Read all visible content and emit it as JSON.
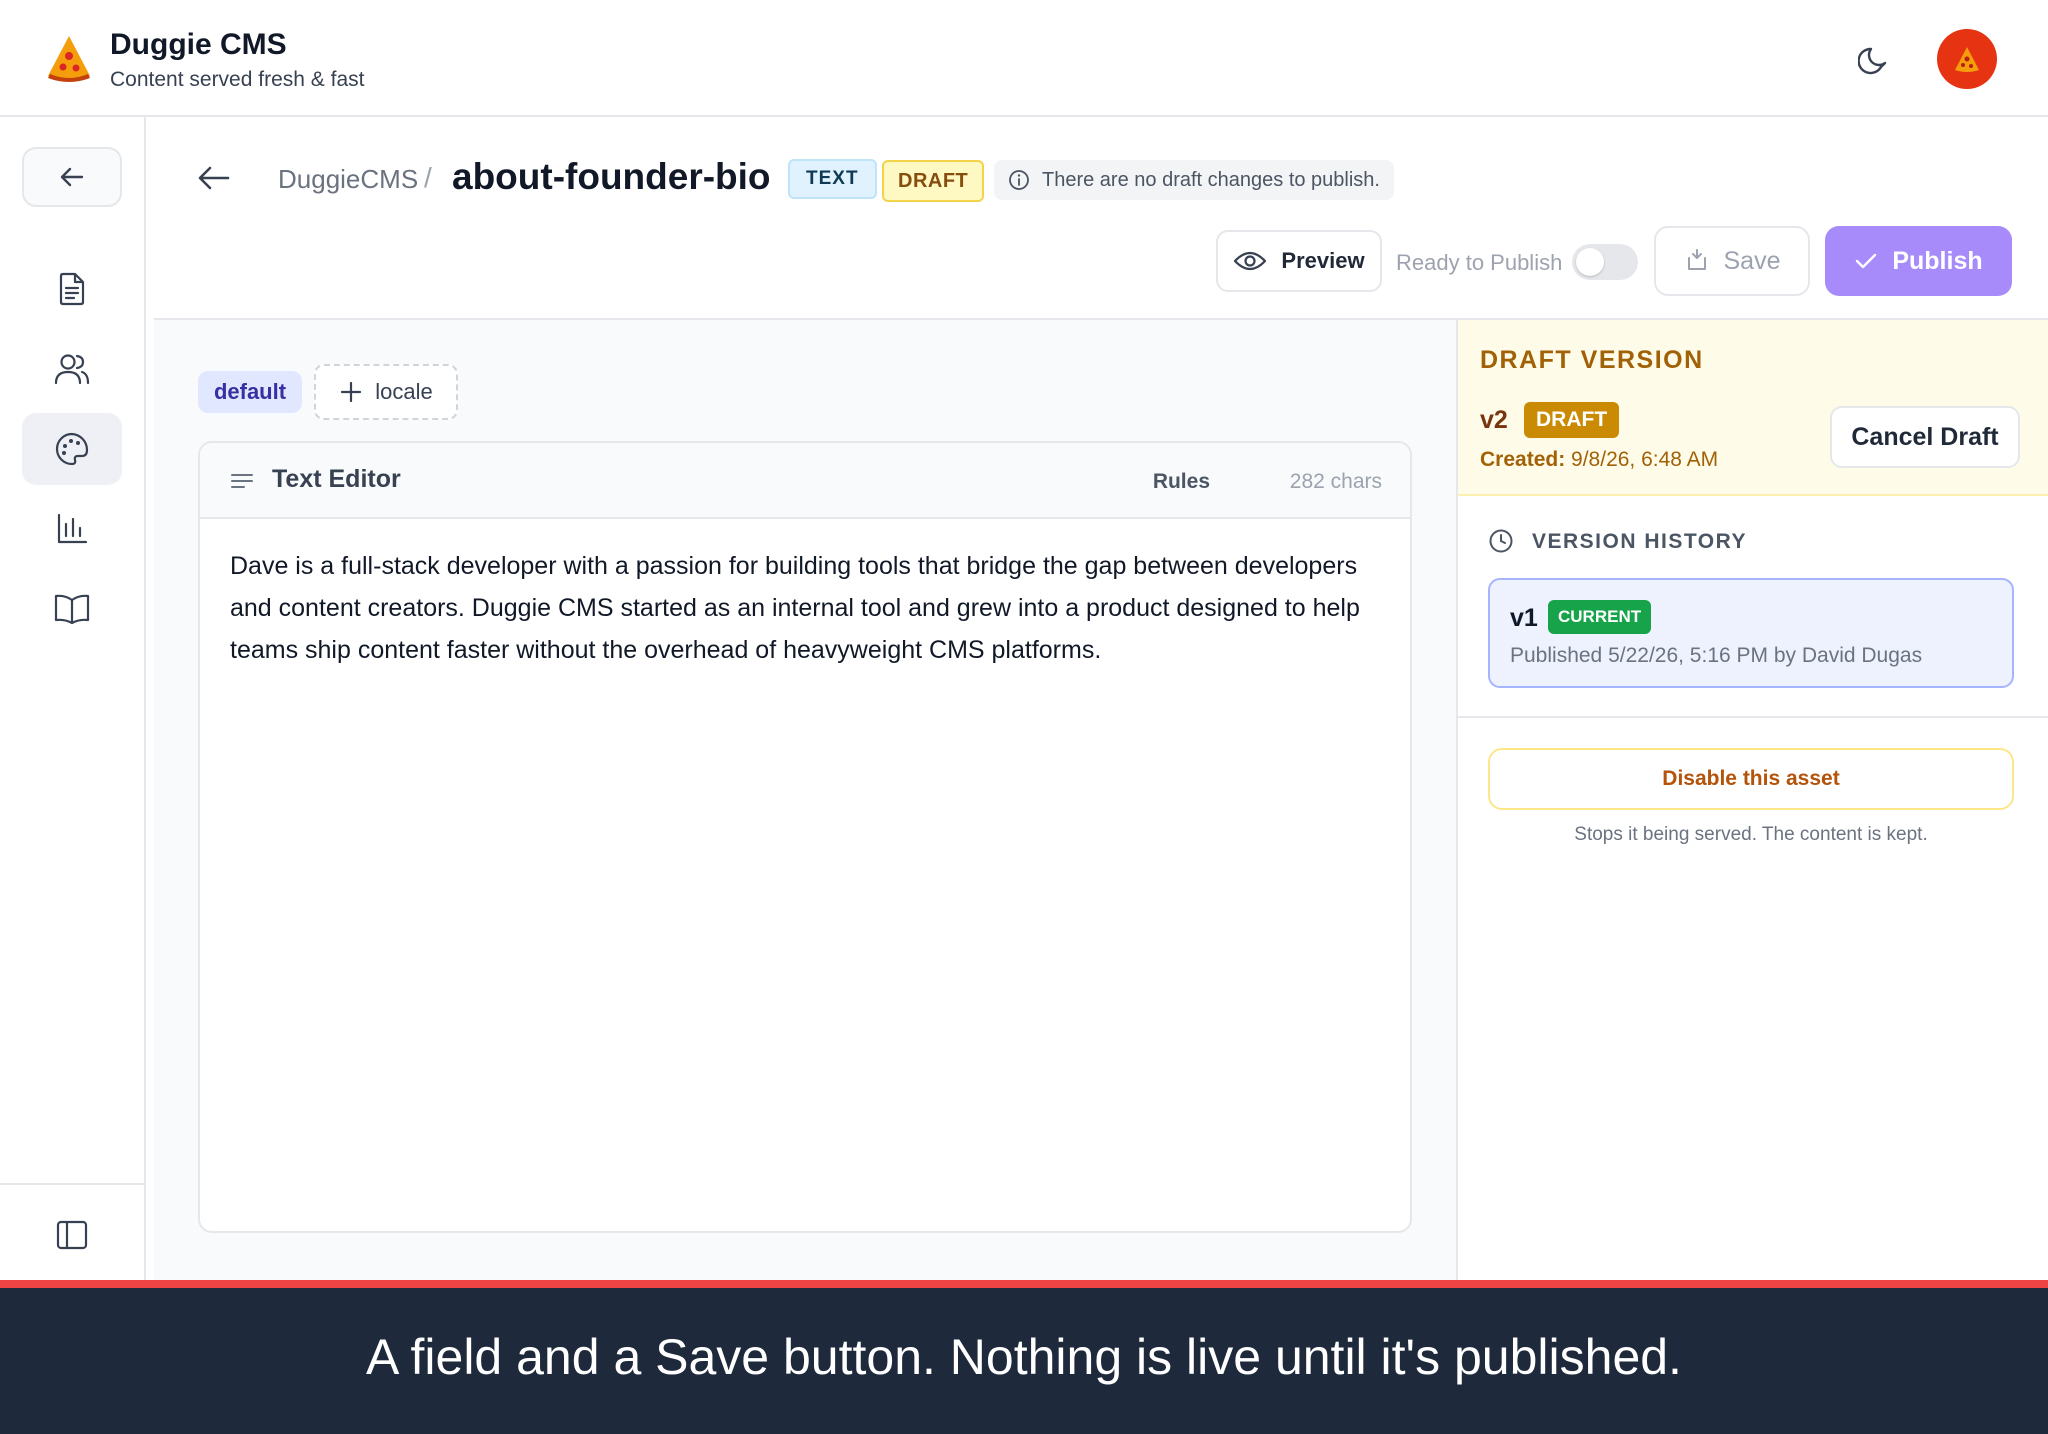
{
  "app": {
    "title": "Duggie CMS",
    "subtitle": "Content served fresh & fast"
  },
  "header": {
    "breadcrumb_root": "DuggieCMS",
    "breadcrumb_separator": "/",
    "asset_name": "about-founder-bio",
    "type_badge": "TEXT",
    "status_badge": "DRAFT",
    "info_message": "There are no draft changes to publish."
  },
  "toolbar": {
    "preview_label": "Preview",
    "ready_label": "Ready to Publish",
    "ready_toggle_on": false,
    "save_label": "Save",
    "publish_label": "Publish"
  },
  "locales": {
    "active": "default",
    "add_label": "locale"
  },
  "editor": {
    "title": "Text Editor",
    "rules_label": "Rules",
    "char_count": "282 chars",
    "content": "Dave is a full-stack developer with a passion for building tools that bridge the gap between developers and content creators. Duggie CMS started as an internal tool and grew into a product designed to help teams ship content faster without the overhead of heavyweight CMS platforms."
  },
  "draft": {
    "section_title": "DRAFT VERSION",
    "version": "v2",
    "badge": "DRAFT",
    "created_label": "Created:",
    "created_value": "9/8/26, 6:48 AM",
    "cancel_label": "Cancel Draft"
  },
  "history": {
    "section_title": "VERSION HISTORY",
    "items": [
      {
        "version": "v1",
        "badge": "CURRENT",
        "meta": "Published 5/22/26, 5:16 PM by David Dugas"
      }
    ]
  },
  "disable": {
    "button_label": "Disable this asset",
    "note": "Stops it being served. The content is kept."
  },
  "caption": "A field and a Save button. Nothing is live until it's published.",
  "colors": {
    "accent_publish": "#a78bfa",
    "draft_badge": "#ca8a04",
    "current_badge": "#16a34a",
    "caption_bg": "#1e293b",
    "caption_border": "#ef4444"
  },
  "icons": {
    "sidebar": [
      "document-icon",
      "users-icon",
      "palette-icon",
      "bar-chart-icon",
      "book-icon"
    ],
    "sidebar_active": "palette-icon"
  }
}
